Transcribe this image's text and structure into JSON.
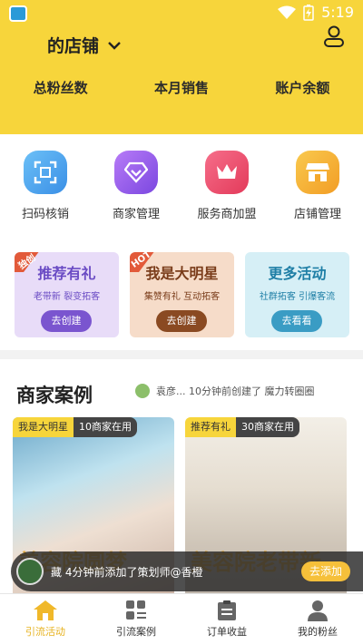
{
  "status_bar": {
    "time": "5:19"
  },
  "header": {
    "store_label": "的店铺",
    "stats": [
      {
        "label": "总粉丝数"
      },
      {
        "label": "本月销售"
      },
      {
        "label": "账户余额"
      }
    ]
  },
  "menu": [
    {
      "label": "扫码核销",
      "icon": "scan-icon",
      "color": "#4aa8f0"
    },
    {
      "label": "商家管理",
      "icon": "diamond-icon",
      "color": "#9b5cf0"
    },
    {
      "label": "服务商加盟",
      "icon": "crown-icon",
      "color": "#ef4b6c"
    },
    {
      "label": "店铺管理",
      "icon": "shop-icon",
      "color": "#f5b32e"
    }
  ],
  "promos": [
    {
      "ribbon": "独创",
      "title": "推荐有礼",
      "subtitle": "老带新 裂变拓客",
      "button": "去创建",
      "bg": "#e8dcf8",
      "title_color": "#6a4bc4",
      "btn_color": "#7a55cf",
      "ribbon_color": "#e25a3a"
    },
    {
      "ribbon": "HOT",
      "title": "我是大明星",
      "subtitle": "集赞有礼 互动拓客",
      "button": "去创建",
      "bg": "#f6dcc9",
      "title_color": "#7a3c1a",
      "btn_color": "#8a4a22",
      "ribbon_color": "#e25a3a"
    },
    {
      "ribbon": "",
      "title": "更多活动",
      "subtitle": "社群拓客 引爆客流",
      "button": "去看看",
      "bg": "#d6eff6",
      "title_color": "#1f7fa6",
      "btn_color": "#3a9cc4",
      "ribbon_color": ""
    }
  ],
  "cases": {
    "title": "商家案例",
    "ticker": "袁彦...    10分钟前创建了 魔力转圈圈",
    "cards": [
      {
        "tag": "我是大明星",
        "count": "10商家在用",
        "overlay": "美容院圆梦"
      },
      {
        "tag": "推荐有礼",
        "count": "30商家在用",
        "overlay": "美容院老带新"
      }
    ]
  },
  "toast": {
    "text": "藏 4分钟前添加了策划师@香橙",
    "button": "去添加"
  },
  "tabs": [
    {
      "label": "引流活动",
      "icon": "home-icon",
      "active": true
    },
    {
      "label": "引流案例",
      "icon": "cases-icon",
      "active": false
    },
    {
      "label": "订单收益",
      "icon": "orders-icon",
      "active": false
    },
    {
      "label": "我的粉丝",
      "icon": "fans-icon",
      "active": false
    }
  ]
}
